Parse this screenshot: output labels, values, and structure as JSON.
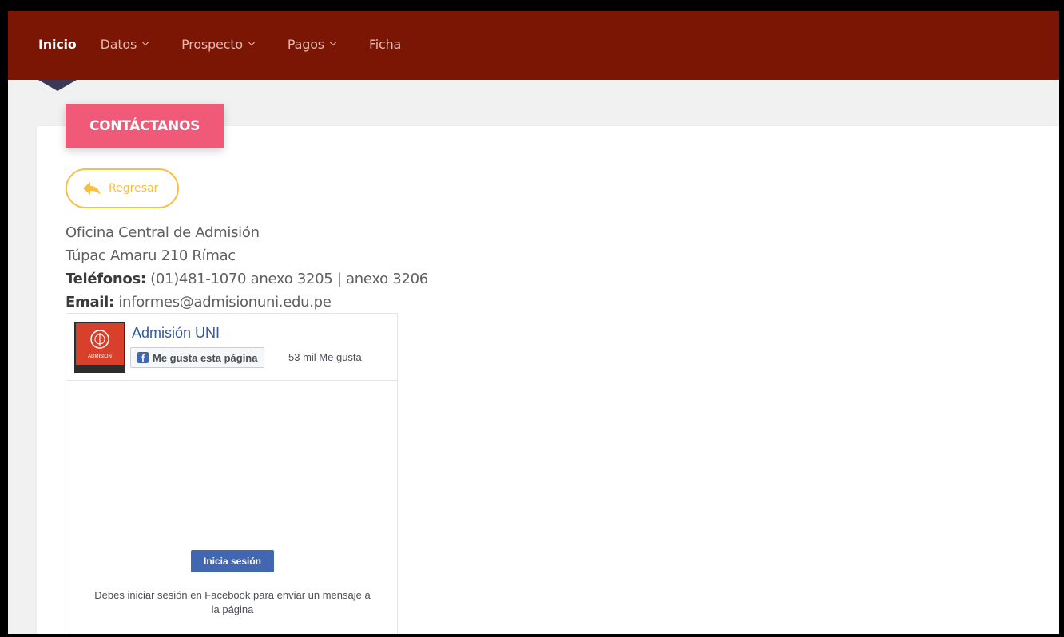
{
  "nav": {
    "items": [
      {
        "label": "Inicio",
        "active": true,
        "dropdown": false
      },
      {
        "label": "Datos",
        "active": false,
        "dropdown": true
      },
      {
        "label": "Prospecto",
        "active": false,
        "dropdown": true
      },
      {
        "label": "Pagos",
        "active": false,
        "dropdown": true
      },
      {
        "label": "Ficha",
        "active": false,
        "dropdown": false
      }
    ]
  },
  "contact": {
    "tab_label": "CONTÁCTANOS",
    "back_label": "Regresar",
    "office": "Oficina Central de Admisión",
    "address": "Túpac Amaru 210 Rímac",
    "phones_label": "Teléfonos:",
    "phones_value": " (01)481-1070 anexo 3205 | anexo 3206",
    "email_label": "Email:",
    "email_value": " informes@admisionuni.edu.pe"
  },
  "facebook": {
    "page_title": "Admisión UNI",
    "like_label": "Me gusta esta página",
    "likes_count": "53 mil Me gusta",
    "login_label": "Inicia sesión",
    "login_message": "Debes iniciar sesión en Facebook para enviar un mensaje a la página",
    "logo_text": "ADMISION"
  },
  "colors": {
    "navbar": "#7b1605",
    "tab": "#f05a78",
    "back_button": "#f7c043",
    "facebook_blue": "#4267b2"
  }
}
